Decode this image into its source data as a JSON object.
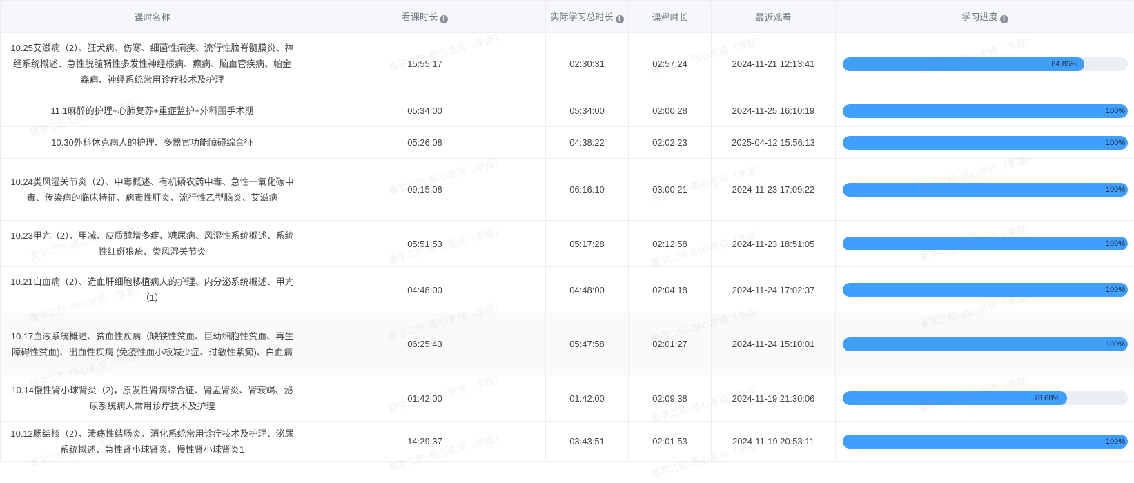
{
  "table": {
    "headers": {
      "name": "课时名称",
      "watch": "看课时长",
      "actual": "实际学习总时长",
      "course": "课程时长",
      "recent": "最近观看",
      "progress": "学习进度"
    },
    "info_icon": "info-circle-icon",
    "rows": [
      {
        "name": "10.25艾滋病（2）、狂犬病、伤寒、细菌性痢疾、流行性脑脊髓膜炎、神经系统概述、急性脱髓鞘性多发性神经根病、癫病、脑血管疾病、帕金森病、神经系统常用诊疗技术及护理",
        "watch": "15:55:17",
        "actual": "02:30:31",
        "course": "02:57:24",
        "recent": "2024-11-21 12:13:41",
        "progress_label": "84.85%",
        "progress": 0.8485
      },
      {
        "name": "11.1麻醉的护理+心肺复苏+重症监护+外科围手术期",
        "watch": "05:34:00",
        "actual": "05:34:00",
        "course": "02:00:28",
        "recent": "2024-11-25 16:10:19",
        "progress_label": "100%",
        "progress": 1.0
      },
      {
        "name": "10.30外科休克病人的护理、多器官功能障碍综合征",
        "watch": "05:26:08",
        "actual": "04:38:22",
        "course": "02:02:23",
        "recent": "2025-04-12 15:56:13",
        "progress_label": "100%",
        "progress": 1.0
      },
      {
        "name": "10.24类风湿关节炎（2）、中毒概述、有机磷农药中毒、急性一氧化碳中毒、传染病的临床特征、病毒性肝炎、流行性乙型脑炎、艾滋病",
        "watch": "09:15:08",
        "actual": "06:16:10",
        "course": "03:00:21",
        "recent": "2024-11-23 17:09:22",
        "progress_label": "100%",
        "progress": 1.0
      },
      {
        "name": "10.23甲亢（2）、甲减、皮质醇增多症、糖尿病、风湿性系统概述、系统性红斑狼疮、类风湿关节炎",
        "watch": "05:51:53",
        "actual": "05:17:28",
        "course": "02:12:58",
        "recent": "2024-11-23 18:51:05",
        "progress_label": "100%",
        "progress": 1.0
      },
      {
        "name": "10.21白血病（2）、造血肝细胞移植病人的护理、内分泌系统概述、甲亢（1）",
        "watch": "04:48:00",
        "actual": "04:48:00",
        "course": "02:04:18",
        "recent": "2024-11-24 17:02:37",
        "progress_label": "100%",
        "progress": 1.0
      },
      {
        "name": "10.17血液系统概述、贫血性疾病（缺铁性贫血、巨幼细胞性贫血、再生障碍性贫血)、出血性疾病 (免疫性血小板减少症、过敏性紫癜)、白血病",
        "watch": "06:25:43",
        "actual": "05:47:58",
        "course": "02:01:27",
        "recent": "2024-11-24 15:10:01",
        "progress_label": "100%",
        "progress": 1.0
      },
      {
        "name": "10.14慢性肾小球肾炎（2)，原发性肾病综合征、肾盂肾炎、肾衰竭、泌尿系统病人常用诊疗技术及护理",
        "watch": "01:42:00",
        "actual": "01:42:00",
        "course": "02:09:38",
        "recent": "2024-11-19 21:30:06",
        "progress_label": "78.68%",
        "progress": 0.7868
      },
      {
        "name": "10.12肠结核（2）、溃疡性结肠炎、消化系统常用诊疗技术及护理、泌尿系统概述、急性肾小球肾炎、慢性肾小球肾炎1",
        "watch": "14:29:37",
        "actual": "03:43:51",
        "course": "02:01:53",
        "recent": "2024-11-19 20:53:11",
        "progress_label": "100%",
        "progress": 1.0
      }
    ]
  },
  "watermark_text": "番学二阶-雨心老师（李磊）",
  "colors": {
    "progress_fill": "#409eff",
    "progress_track": "#ebeef5",
    "header_bg": "#f5f7fa",
    "border": "#ebeef5"
  }
}
